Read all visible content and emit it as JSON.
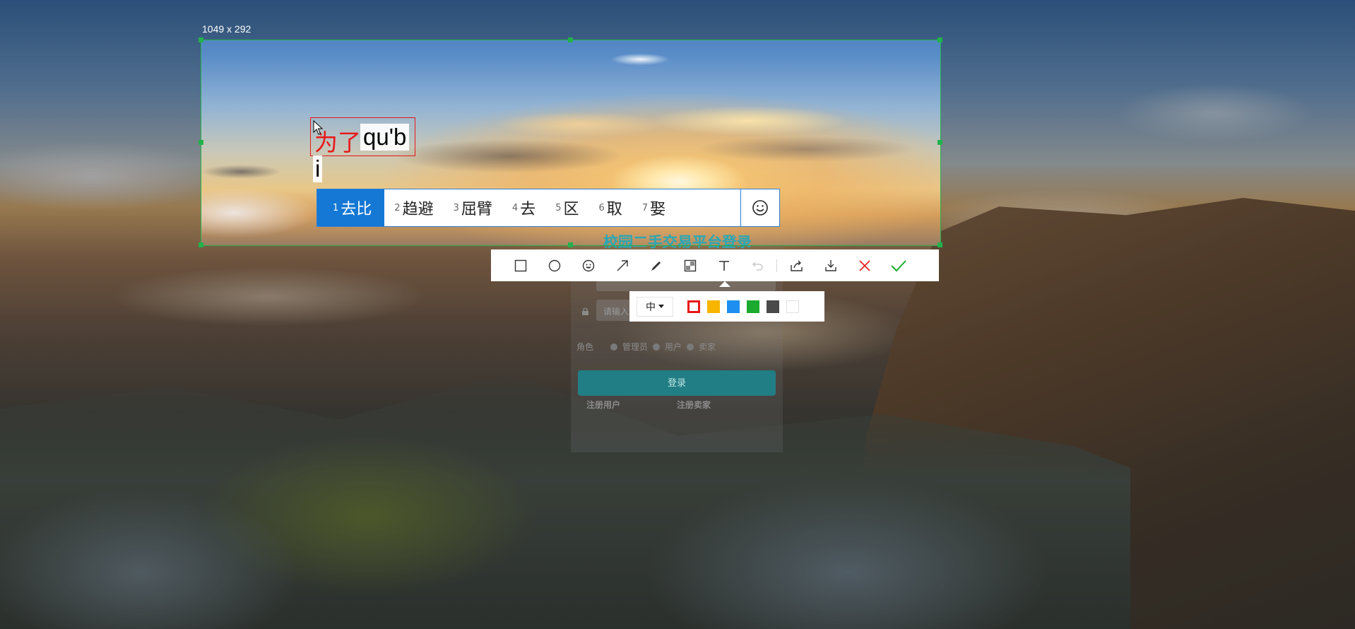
{
  "capture": {
    "size_label": "1049 x 292"
  },
  "login_page": {
    "title": "校园二手交易平台登录",
    "password_placeholder": "请输入",
    "role_label": "角色",
    "roles": [
      "管理员",
      "用户",
      "卖家"
    ],
    "login_button": "登录",
    "register_user": "注册用户",
    "register_seller": "注册卖家"
  },
  "text_annotation": {
    "committed_text": "为了",
    "composition_text": "qu'b",
    "composition_cont": "i"
  },
  "ime": {
    "candidates": [
      {
        "index": "1",
        "text": "去比"
      },
      {
        "index": "2",
        "text": "趋避"
      },
      {
        "index": "3",
        "text": "屈臂"
      },
      {
        "index": "4",
        "text": "去"
      },
      {
        "index": "5",
        "text": "区"
      },
      {
        "index": "6",
        "text": "取"
      },
      {
        "index": "7",
        "text": "娶"
      }
    ],
    "emoji_icon": "smiley-icon"
  },
  "toolbar": {
    "tools": [
      "rectangle-icon",
      "ellipse-icon",
      "sticker-icon",
      "arrow-icon",
      "pen-icon",
      "mosaic-icon",
      "text-icon",
      "undo-icon",
      "share-icon",
      "download-icon",
      "close-icon",
      "confirm-icon"
    ],
    "font_size": "中",
    "colors": [
      "#e81818",
      "#f7b500",
      "#1e8ff0",
      "#1aab2f",
      "#4a4a4a",
      "#ffffff"
    ],
    "selected_color": "#e81818"
  }
}
